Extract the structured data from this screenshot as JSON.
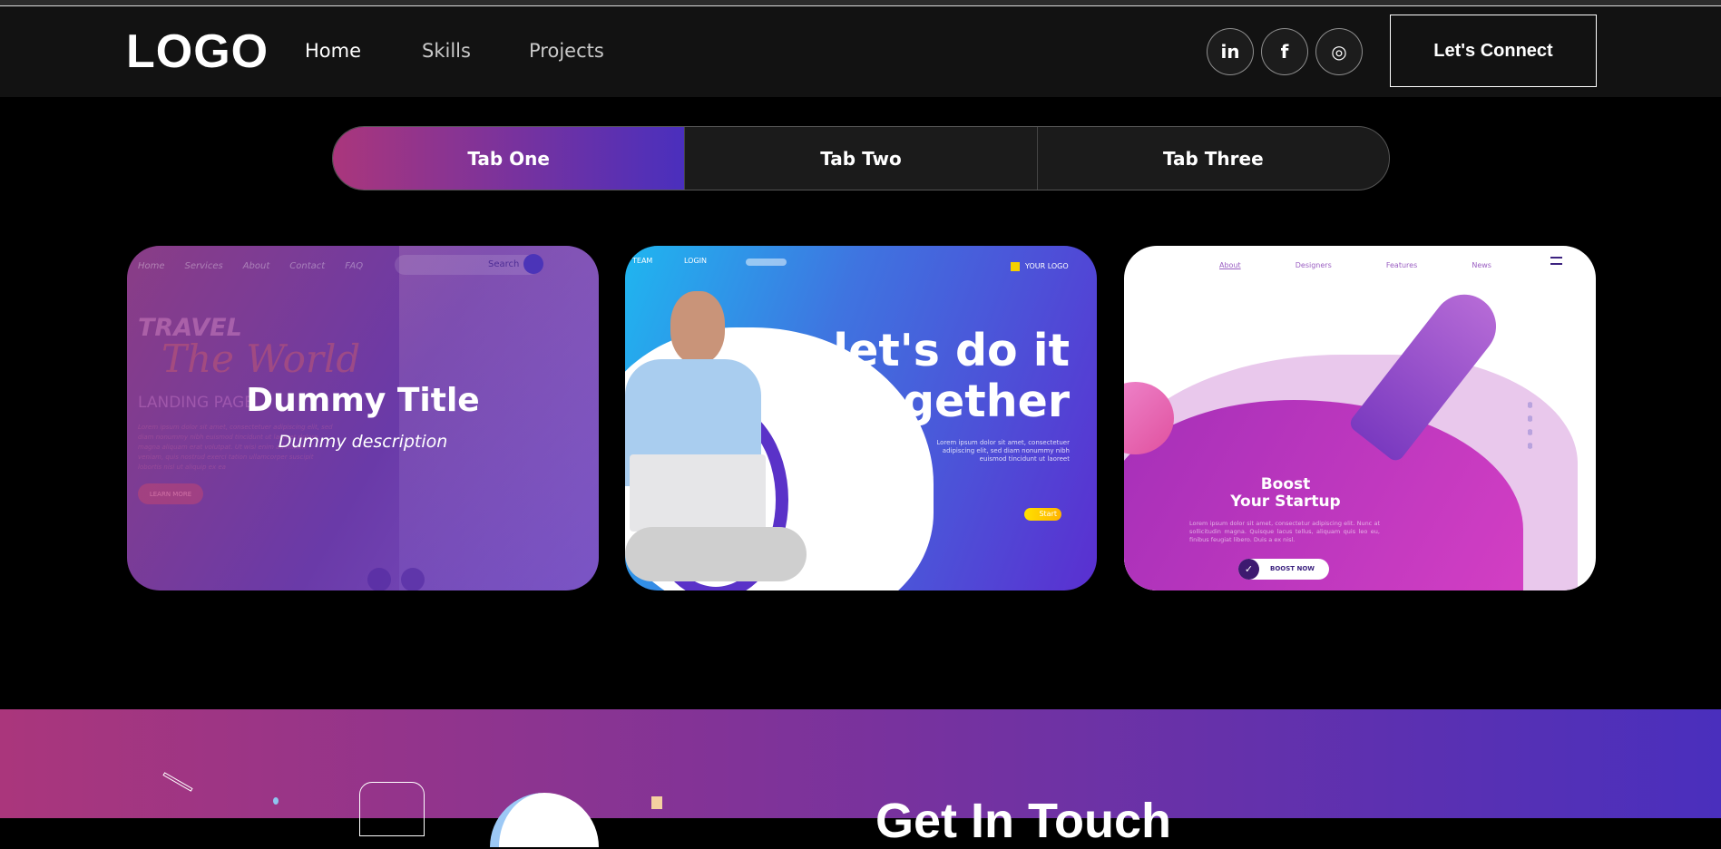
{
  "nav": {
    "logo": "LOGO",
    "links": [
      "Home",
      "Skills",
      "Projects"
    ],
    "social": [
      {
        "icon": "linkedin-icon",
        "label": "in"
      },
      {
        "icon": "facebook-icon",
        "label": "f"
      },
      {
        "icon": "instagram-icon",
        "label": "◎"
      }
    ],
    "connect": "Let's Connect"
  },
  "tabs": [
    "Tab One",
    "Tab Two",
    "Tab Three"
  ],
  "cards": [
    {
      "title": "Dummy Title",
      "description": "Dummy description",
      "mock": {
        "nav": [
          "Home",
          "Services",
          "About",
          "Contact",
          "FAQ"
        ],
        "search": "Search",
        "h1": "TRAVEL",
        "h2": "The World",
        "h3": "LANDING PAGE",
        "body": "Lorem ipsum dolor sit amet, consectetuer adipiscing elit, sed diam nonummy nibh euismod tincidunt ut laoreet dolore magna aliquam erat volutpat. Ut wisi enim ad minim veniam, quis nostrud exerci tation ullamcorper suscipit lobortis nisl ut aliquip ex ea",
        "button": "LEARN MORE"
      }
    },
    {
      "mock": {
        "nav": [
          "TEAM",
          "LOGIN"
        ],
        "logo": "YOUR LOGO",
        "headline": "let's do it together",
        "body": "Lorem ipsum dolor sit amet, consectetuer adipiscing elit, sed diam nonummy nibh euismod tincidunt ut laoreet",
        "button": "Start"
      }
    },
    {
      "mock": {
        "nav": [
          "About",
          "Designers",
          "Features",
          "News"
        ],
        "headline1": "Boost",
        "headline2": "Your Startup",
        "body": "Lorem ipsum dolor sit amet, consectetur adipiscing elit. Nunc at sollicitudin magna. Quisque lacus tellus, aliquam quis leo eu, finibus feugiat libero. Duis a ex nisl.",
        "button": "BOOST NOW"
      }
    }
  ],
  "contact": {
    "title": "Get In Touch"
  },
  "colors": {
    "gradient_start": "#aa367c",
    "gradient_end": "#4a2fbd"
  }
}
